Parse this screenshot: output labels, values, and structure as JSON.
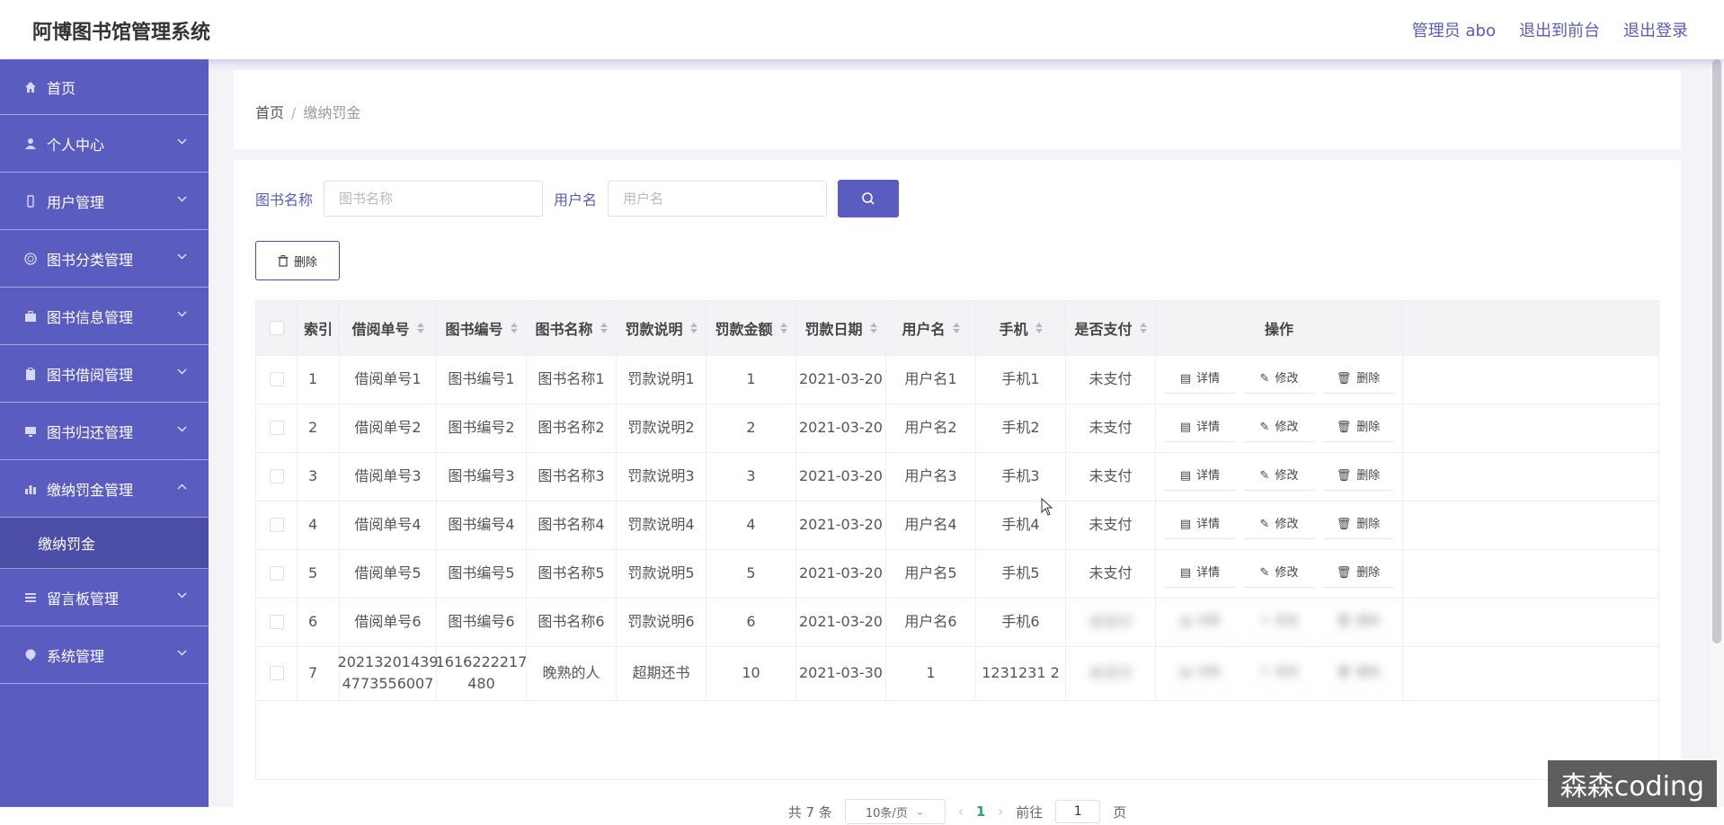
{
  "header": {
    "title": "阿博图书馆管理系统",
    "links": [
      "管理员 abo",
      "退出到前台",
      "退出登录"
    ]
  },
  "sidebar": {
    "items": [
      {
        "label": "首页",
        "icon": "home-icon",
        "expandable": false
      },
      {
        "label": "个人中心",
        "icon": "user-icon",
        "expandable": true
      },
      {
        "label": "用户管理",
        "icon": "phone-icon",
        "expandable": true
      },
      {
        "label": "图书分类管理",
        "icon": "globe-icon",
        "expandable": true
      },
      {
        "label": "图书信息管理",
        "icon": "briefcase-icon",
        "expandable": true
      },
      {
        "label": "图书借阅管理",
        "icon": "clipboard-icon",
        "expandable": true
      },
      {
        "label": "图书归还管理",
        "icon": "monitor-icon",
        "expandable": true
      },
      {
        "label": "缴纳罚金管理",
        "icon": "chart-icon",
        "expandable": true,
        "expanded": true
      },
      {
        "label": "留言板管理",
        "icon": "list-icon",
        "expandable": true
      },
      {
        "label": "系统管理",
        "icon": "palette-icon",
        "expandable": true
      }
    ],
    "submenu": "缴纳罚金"
  },
  "breadcrumb": {
    "home": "首页",
    "separator": "/",
    "current": "缴纳罚金"
  },
  "search": {
    "book_label": "图书名称",
    "book_placeholder": "图书名称",
    "user_label": "用户名",
    "user_placeholder": "用户名"
  },
  "toolbar": {
    "delete_label": "删除"
  },
  "table": {
    "headers": [
      "索引",
      "借阅单号",
      "图书编号",
      "图书名称",
      "罚款说明",
      "罚款金额",
      "罚款日期",
      "用户名",
      "手机",
      "是否支付",
      "操作"
    ],
    "rows": [
      [
        "1",
        "借阅单号1",
        "图书编号1",
        "图书名称1",
        "罚款说明1",
        "1",
        "2021-03-20",
        "用户名1",
        "手机1",
        "未支付"
      ],
      [
        "2",
        "借阅单号2",
        "图书编号2",
        "图书名称2",
        "罚款说明2",
        "2",
        "2021-03-20",
        "用户名2",
        "手机2",
        "未支付"
      ],
      [
        "3",
        "借阅单号3",
        "图书编号3",
        "图书名称3",
        "罚款说明3",
        "3",
        "2021-03-20",
        "用户名3",
        "手机3",
        "未支付"
      ],
      [
        "4",
        "借阅单号4",
        "图书编号4",
        "图书名称4",
        "罚款说明4",
        "4",
        "2021-03-20",
        "用户名4",
        "手机4",
        "未支付"
      ],
      [
        "5",
        "借阅单号5",
        "图书编号5",
        "图书名称5",
        "罚款说明5",
        "5",
        "2021-03-20",
        "用户名5",
        "手机5",
        "未支付"
      ],
      [
        "6",
        "借阅单号6",
        "图书编号6",
        "图书名称6",
        "罚款说明6",
        "6",
        "2021-03-20",
        "用户名6",
        "手机6",
        "未支付"
      ],
      [
        "7",
        "202132014394773556007",
        "1616222217480",
        "晚熟的人",
        "超期还书",
        "10",
        "2021-03-30",
        "1",
        "123123112",
        "未支付"
      ]
    ],
    "row_display": {
      "6": {
        "1": "20213201439 4773556007",
        "2": "1616222217 480",
        "8": "1231231 2"
      }
    },
    "actions": {
      "detail": "详情",
      "edit": "修改",
      "delete": "删除"
    }
  },
  "pagination": {
    "total": "共 7 条",
    "page_size": "10条/页",
    "current_page": "1",
    "goto_label": "前往",
    "goto_value": "1",
    "page_suffix": "页"
  },
  "watermark": "森森coding",
  "colors": {
    "accent": "#5a5cbf",
    "accent_dark": "#4b4da7",
    "active_page": "#2aa57e"
  }
}
